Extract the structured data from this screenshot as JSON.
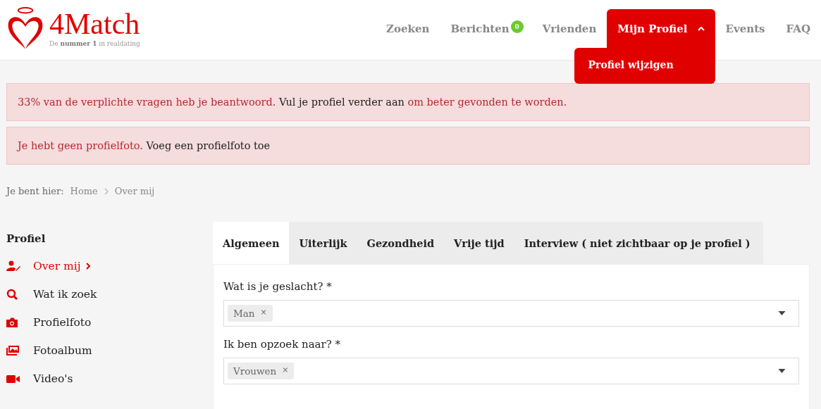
{
  "logo": {
    "name": "4Match",
    "tagline": "De **nummer 1** in realdating"
  },
  "nav": [
    {
      "label": "Zoeken",
      "selected": false
    },
    {
      "label": "Berichten",
      "selected": false,
      "badge": "0"
    },
    {
      "label": "Vrienden",
      "selected": false
    },
    {
      "label": "Mijn Profiel",
      "selected": true,
      "expanded": true,
      "submenu": [
        "Profiel wijzigen"
      ]
    },
    {
      "label": "Events",
      "selected": false
    },
    {
      "label": "FAQ",
      "selected": false
    }
  ],
  "alerts": [
    {
      "parts": [
        {
          "text": "33% van de verplichte vragen heb je beantwoord.",
          "kind": "emphasis"
        },
        {
          "text": " Vul je profiel verder aan ",
          "kind": "plain"
        },
        {
          "text": "om beter gevonden te worden.",
          "kind": "emphasis"
        }
      ]
    },
    {
      "parts": [
        {
          "text": "Je hebt geen profielfoto.",
          "kind": "emphasis"
        },
        {
          "text": " Voeg een profielfoto toe",
          "kind": "plain"
        }
      ]
    }
  ],
  "breadcrumb": {
    "prefix": "Je bent hier:",
    "items": [
      "Home",
      "Over mij"
    ]
  },
  "sidebar": {
    "title": "Profiel",
    "items": [
      {
        "label": "Over mij",
        "selected": true
      },
      {
        "label": "Wat ik zoek",
        "selected": false
      },
      {
        "label": "Profielfoto",
        "selected": false
      },
      {
        "label": "Fotoalbum",
        "selected": false
      },
      {
        "label": "Video's",
        "selected": false
      }
    ]
  },
  "tabs": [
    {
      "label": "Algemeen",
      "selected": true
    },
    {
      "label": "Uiterlijk",
      "selected": false
    },
    {
      "label": "Gezondheid",
      "selected": false
    },
    {
      "label": "Vrije tijd",
      "selected": false
    },
    {
      "label": "Interview ( niet zichtbaar op je profiel )",
      "selected": false
    }
  ],
  "fields": [
    {
      "label": "Wat is je geslacht? *",
      "tags": [
        {
          "text": "Man",
          "remove": "×"
        }
      ]
    },
    {
      "label": "Ik ben opzoek naar? *",
      "tags": [
        {
          "text": "Vrouwen",
          "remove": "×"
        }
      ]
    }
  ]
}
